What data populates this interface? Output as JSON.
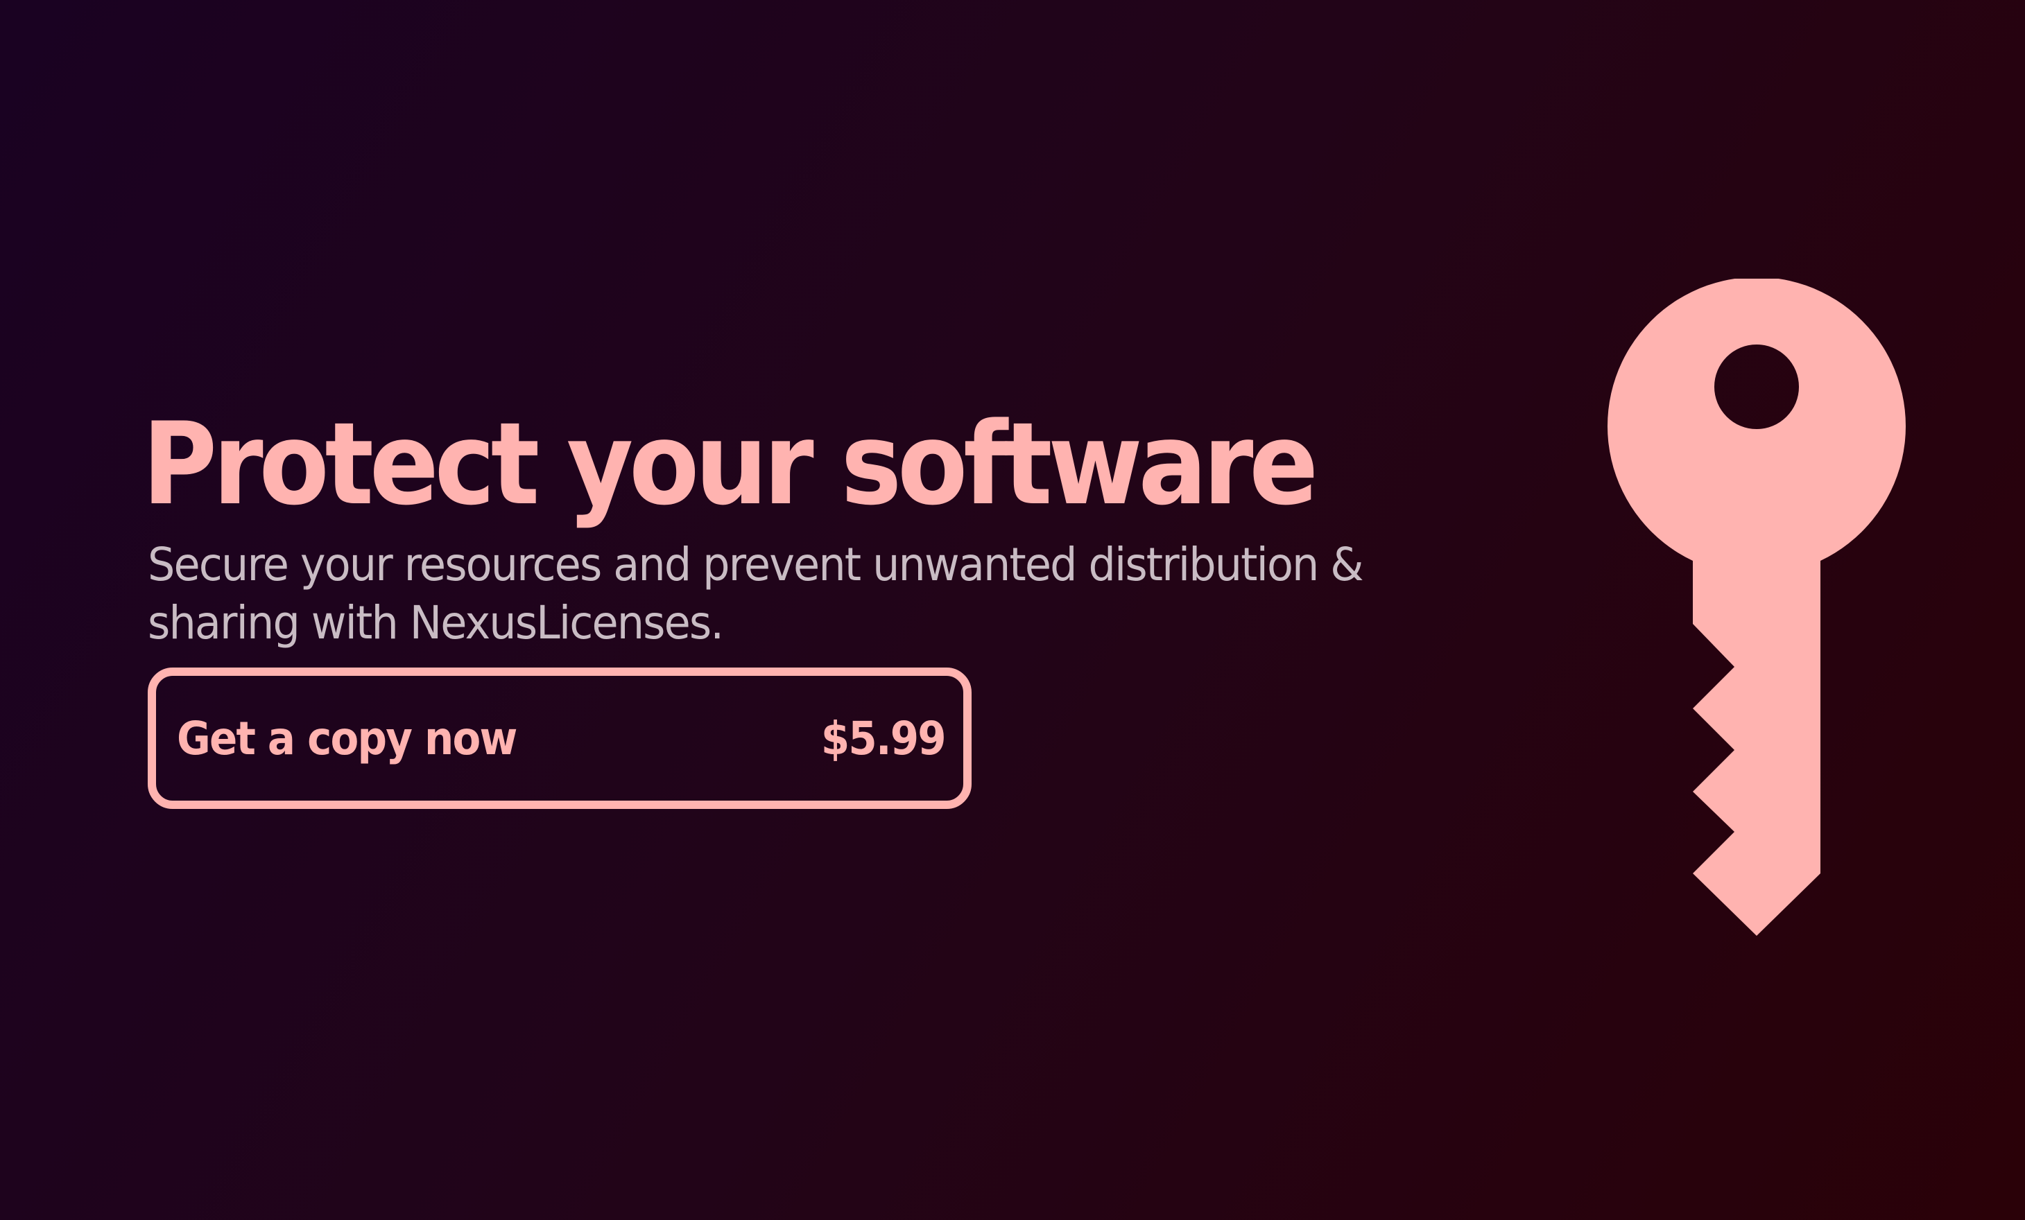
{
  "hero": {
    "headline": "Protect your software",
    "subtext": "Secure your resources and prevent unwanted distribution & sharing with NexusLicenses."
  },
  "cta": {
    "label": "Get a copy now",
    "price": "$5.99"
  },
  "icons": {
    "illustration": "key-icon"
  },
  "colors": {
    "accent": "#ffb3b0",
    "body_text": "#c9bcc4",
    "background_start": "#1a0222",
    "background_end": "#2a0108"
  }
}
